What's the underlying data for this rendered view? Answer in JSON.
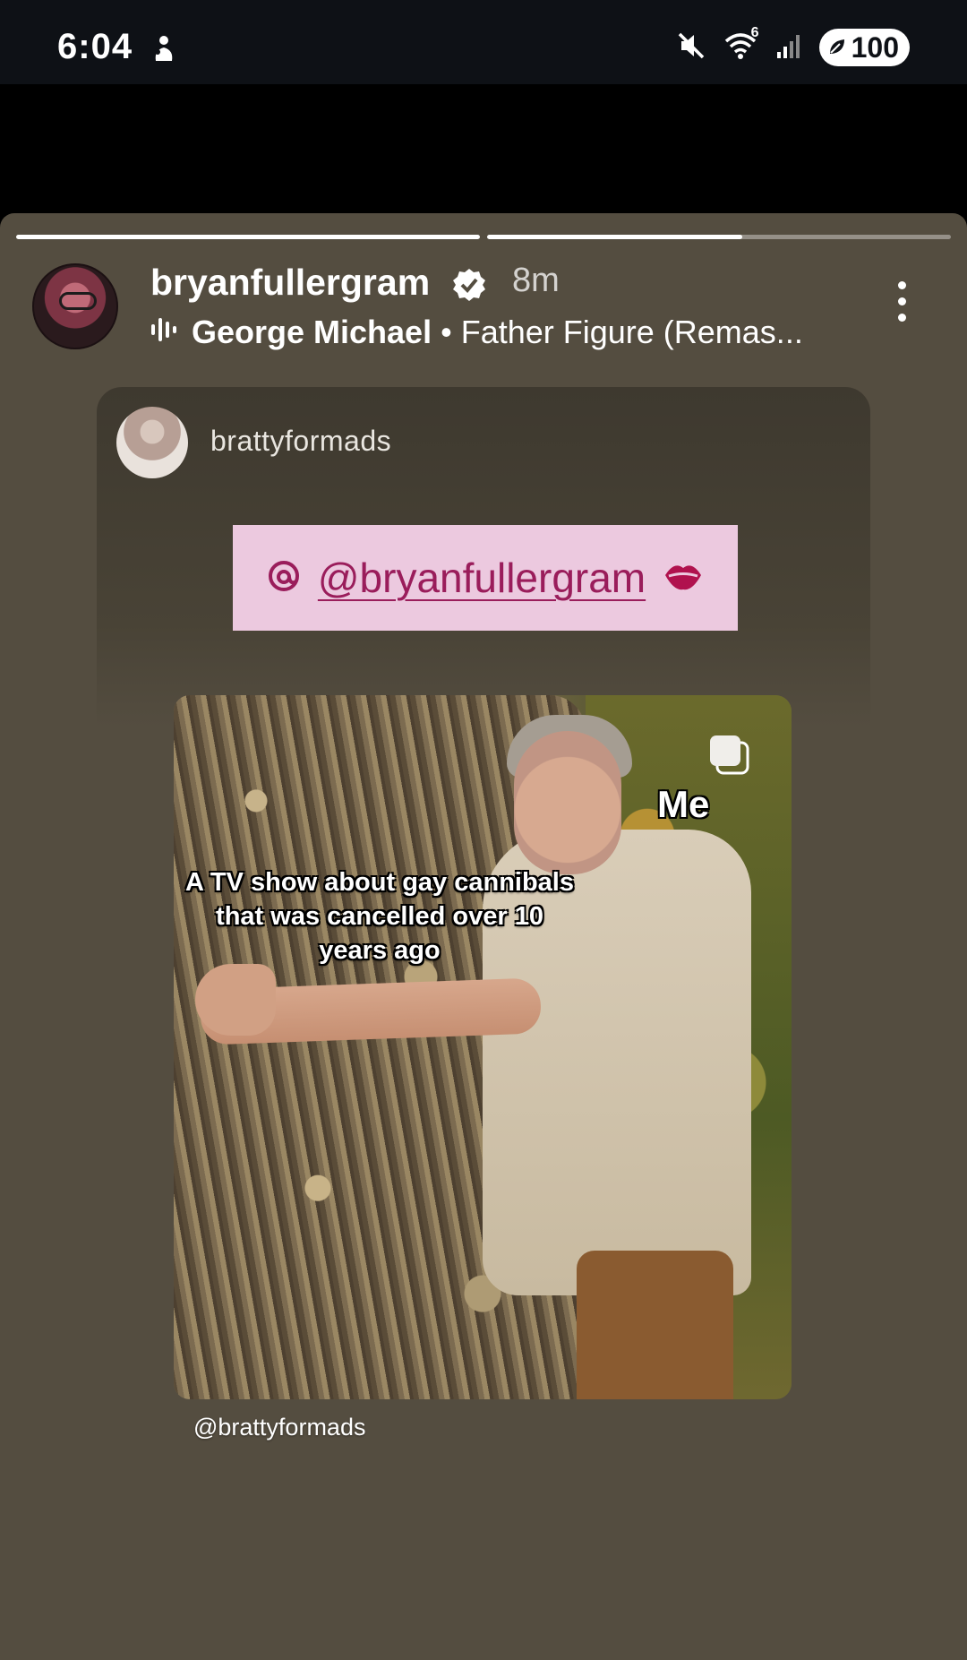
{
  "status_bar": {
    "time": "6:04",
    "battery": "100",
    "signal_label": "6"
  },
  "story": {
    "progress": [
      1.0,
      0.55
    ],
    "username": "bryanfullergram",
    "time_ago": "8m",
    "music": {
      "artist": "George Michael",
      "separator": "•",
      "song": "Father Figure (Remas..."
    }
  },
  "shared_post": {
    "username": "brattyformads",
    "mention": "@bryanfullergram",
    "meme": {
      "caption": "A TV show about gay cannibals that was cancelled over 10 years ago",
      "label": "Me"
    },
    "watermark": "@brattyformads"
  },
  "colors": {
    "story_background": "#544d40",
    "status_bar": "#0e1116",
    "mention_bg": "#ecc9df",
    "mention_text": "#9a1d5b"
  },
  "icons": [
    "person-notification-icon",
    "mute-icon",
    "wifi-icon",
    "cell-signal-icon",
    "battery-saver-icon",
    "verified-icon",
    "music-bars-icon",
    "more-icon",
    "threads-icon",
    "lips-icon",
    "carousel-icon"
  ]
}
